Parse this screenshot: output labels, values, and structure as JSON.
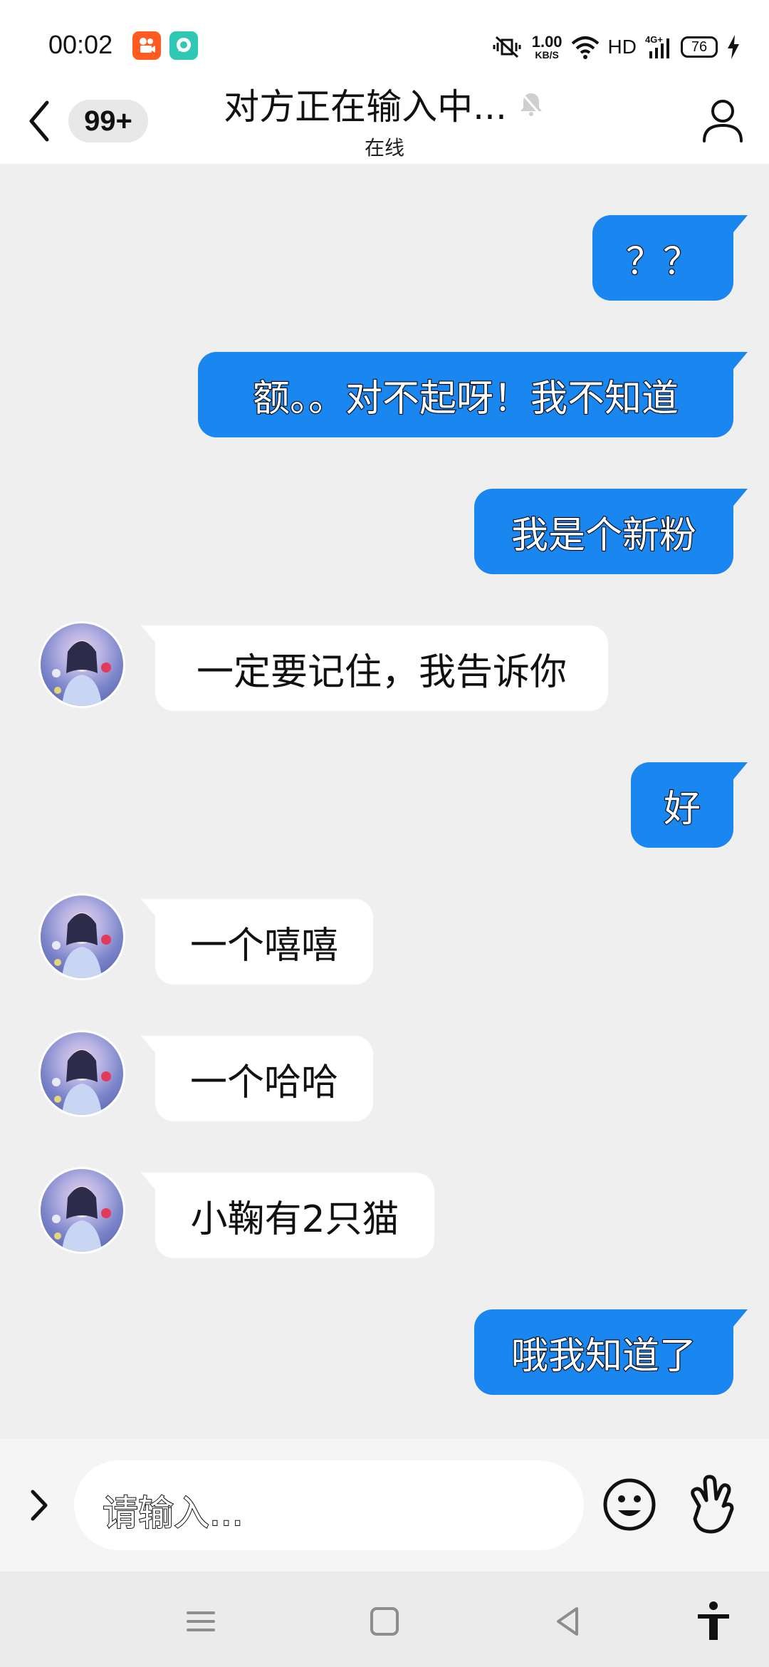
{
  "status_bar": {
    "time": "00:02",
    "net_speed_value": "1.00",
    "net_speed_unit": "KB/S",
    "hd_label": "HD",
    "signal_label": "4G+",
    "battery_level": "76",
    "icons": [
      "kuaishou-app-icon",
      "chat-app-icon",
      "vibrate-mute-icon",
      "wifi-icon",
      "signal-icon",
      "battery-icon",
      "charging-icon"
    ]
  },
  "header": {
    "unread_count": "99+",
    "title": "对方正在输入中...",
    "status": "在线"
  },
  "messages": [
    {
      "direction": "out",
      "text": "？？"
    },
    {
      "direction": "out",
      "text": "额。。对不起呀！我不知道"
    },
    {
      "direction": "out",
      "text": "我是个新粉"
    },
    {
      "direction": "in",
      "text": "一定要记住，我告诉你"
    },
    {
      "direction": "out",
      "text": "好"
    },
    {
      "direction": "in",
      "text": "一个嘻嘻"
    },
    {
      "direction": "in",
      "text": "一个哈哈"
    },
    {
      "direction": "in",
      "text": "小鞠有2只猫"
    },
    {
      "direction": "out",
      "text": "哦我知道了"
    }
  ],
  "input": {
    "placeholder": "请输入..."
  },
  "colors": {
    "outgoing_bubble": "#1a86f0",
    "incoming_bubble": "#ffffff",
    "chat_background": "#efefef"
  }
}
